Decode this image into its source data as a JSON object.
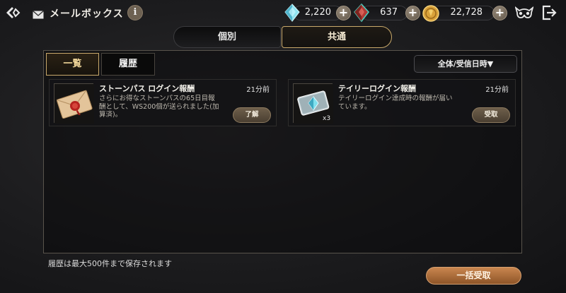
{
  "header": {
    "title": "メールボックス",
    "info_label": "i"
  },
  "currencies": [
    {
      "name": "blue-crystal",
      "value": "2,220",
      "color": "#7fd6e6"
    },
    {
      "name": "red-crystal",
      "value": "637",
      "color": "#c0433a"
    },
    {
      "name": "gold-coin",
      "value": "22,728",
      "color": "#d9a23a"
    }
  ],
  "main_tabs": [
    {
      "label": "個別",
      "active": false
    },
    {
      "label": "共通",
      "active": true
    }
  ],
  "sub_tabs": [
    {
      "label": "一覧",
      "active": true
    },
    {
      "label": "履歴",
      "active": false
    }
  ],
  "sort": {
    "label": "全体/受信日時▼"
  },
  "mails": [
    {
      "title": "ストーンパス ログイン報酬",
      "time": "21分前",
      "desc": "さらにお得なストーンパスの65日目報酬として、WS200個が送られました(加算済)。",
      "button": "了解",
      "icon": "letter-seal-icon"
    },
    {
      "title": "テイリーログイン報酬",
      "time": "21分前",
      "desc": "テイリーログイン達成時の報酬が届いています。",
      "button": "受取",
      "icon": "crystal-pack-icon",
      "qty": "x3"
    }
  ],
  "footer": {
    "note": "履歴は最大500件まで保存されます",
    "bulk_button": "一括受取"
  },
  "colors": {
    "accent_gold": "#c9a96b",
    "bulk_orange": "#b87442"
  }
}
